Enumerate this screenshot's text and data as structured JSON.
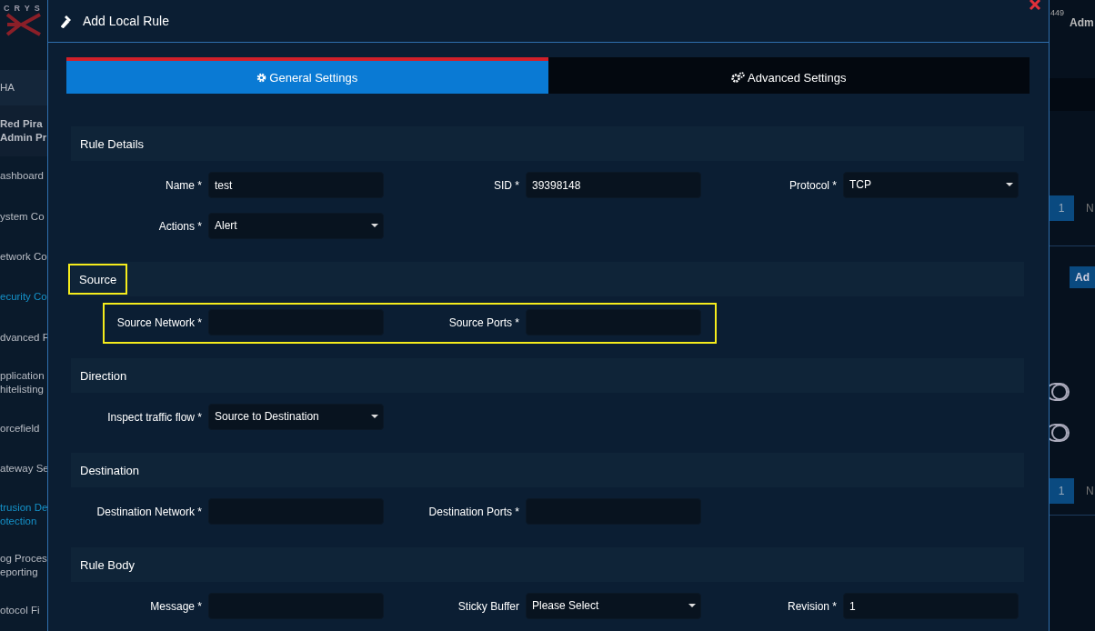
{
  "sidebar": {
    "logo": "CRYS",
    "items": [
      {
        "kind": "band",
        "lines": [
          "HA"
        ],
        "highlighted": false
      },
      {
        "kind": "profile",
        "lines": [
          "Red Pira",
          "Admin Pr"
        ],
        "highlighted": false
      },
      {
        "kind": "link",
        "lines": [
          "ashboard"
        ],
        "highlighted": false
      },
      {
        "kind": "link",
        "lines": [
          "ystem Co"
        ],
        "highlighted": false
      },
      {
        "kind": "link",
        "lines": [
          "etwork Co"
        ],
        "highlighted": false
      },
      {
        "kind": "link",
        "lines": [
          "ecurity Co"
        ],
        "highlighted": true
      },
      {
        "kind": "link",
        "lines": [
          "dvanced F"
        ],
        "highlighted": false
      },
      {
        "kind": "link",
        "lines": [
          "pplication",
          "hitelisting"
        ],
        "highlighted": false
      },
      {
        "kind": "link",
        "lines": [
          "orcefield"
        ],
        "highlighted": false
      },
      {
        "kind": "link",
        "lines": [
          "ateway Se"
        ],
        "highlighted": false
      },
      {
        "kind": "link",
        "lines": [
          "trusion De",
          "otection"
        ],
        "highlighted": true
      },
      {
        "kind": "link",
        "lines": [
          "og Proces",
          "eporting"
        ],
        "highlighted": false
      },
      {
        "kind": "link",
        "lines": [
          "otocol Fi"
        ],
        "highlighted": false
      }
    ]
  },
  "topbar": {
    "notification_count": "449",
    "user": "Adm"
  },
  "background": {
    "pagers": [
      {
        "page": "1",
        "next": "N"
      },
      {
        "page": "1",
        "next": "N"
      }
    ],
    "add_button": "Ad"
  },
  "modal": {
    "title": "Add Local Rule",
    "tabs": [
      {
        "label": "General Settings",
        "selected": true
      },
      {
        "label": "Advanced Settings",
        "selected": false
      }
    ],
    "sections": [
      {
        "title": "Rule Details",
        "highlighted": false,
        "rows": [
          {
            "highlighted": false,
            "fields": [
              {
                "kind": "text",
                "label": "Name *",
                "value": "test"
              },
              {
                "kind": "text",
                "label": "SID *",
                "value": "39398148"
              },
              {
                "kind": "select",
                "label": "Protocol *",
                "value": "TCP"
              }
            ]
          },
          {
            "highlighted": false,
            "fields": [
              {
                "kind": "select",
                "label": "Actions *",
                "value": "Alert"
              }
            ]
          }
        ]
      },
      {
        "title": "Source",
        "highlighted": true,
        "rows": [
          {
            "highlighted": true,
            "fields": [
              {
                "kind": "text",
                "label": "Source Network *"
              },
              {
                "kind": "text",
                "label": "Source Ports *"
              }
            ]
          }
        ]
      },
      {
        "title": "Direction",
        "highlighted": false,
        "rows": [
          {
            "highlighted": false,
            "fields": [
              {
                "kind": "select",
                "label": "Inspect traffic flow *",
                "value": "Source to Destination"
              }
            ]
          }
        ]
      },
      {
        "title": "Destination",
        "highlighted": false,
        "rows": [
          {
            "highlighted": false,
            "fields": [
              {
                "kind": "text",
                "label": "Destination Network *"
              },
              {
                "kind": "text",
                "label": "Destination Ports *"
              }
            ]
          }
        ]
      },
      {
        "title": "Rule Body",
        "highlighted": false,
        "rows": [
          {
            "highlighted": false,
            "fields": [
              {
                "kind": "text",
                "label": "Message *"
              },
              {
                "kind": "select",
                "label": "Sticky Buffer",
                "value": "Please Select"
              },
              {
                "kind": "text",
                "label": "Revision *",
                "value": "1"
              }
            ]
          }
        ]
      }
    ]
  }
}
